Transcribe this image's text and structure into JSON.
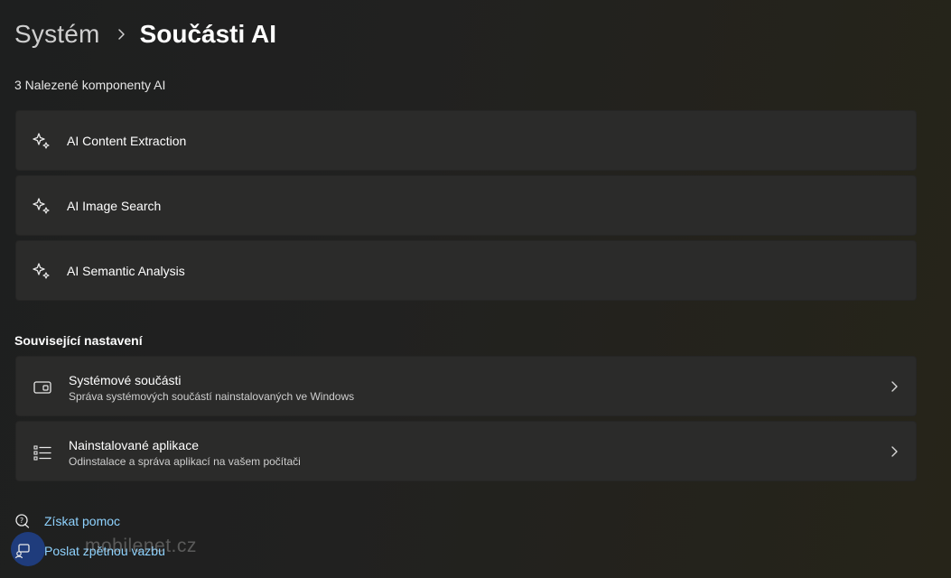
{
  "breadcrumb": {
    "parent": "Systém",
    "current": "Součásti AI"
  },
  "components": {
    "count_label": "3 Nalezené komponenty AI",
    "items": [
      {
        "label": "AI Content Extraction",
        "icon": "sparkle-icon"
      },
      {
        "label": "AI Image Search",
        "icon": "sparkle-icon"
      },
      {
        "label": "AI Semantic Analysis",
        "icon": "sparkle-icon"
      }
    ]
  },
  "related": {
    "title": "Související nastavení",
    "items": [
      {
        "title": "Systémové součásti",
        "subtitle": "Správa systémových součástí nainstalovaných ve Windows",
        "icon": "window-icon"
      },
      {
        "title": "Nainstalované aplikace",
        "subtitle": "Odinstalace a správa aplikací na vašem počítači",
        "icon": "list-icon"
      }
    ]
  },
  "links": {
    "help": "Získat pomoc",
    "feedback": "Poslat zpětnou vazbu"
  },
  "watermark": "mobilenet.cz",
  "colors": {
    "link": "#8fd3ff",
    "card": "#2b2b2a",
    "background": "#202020"
  }
}
